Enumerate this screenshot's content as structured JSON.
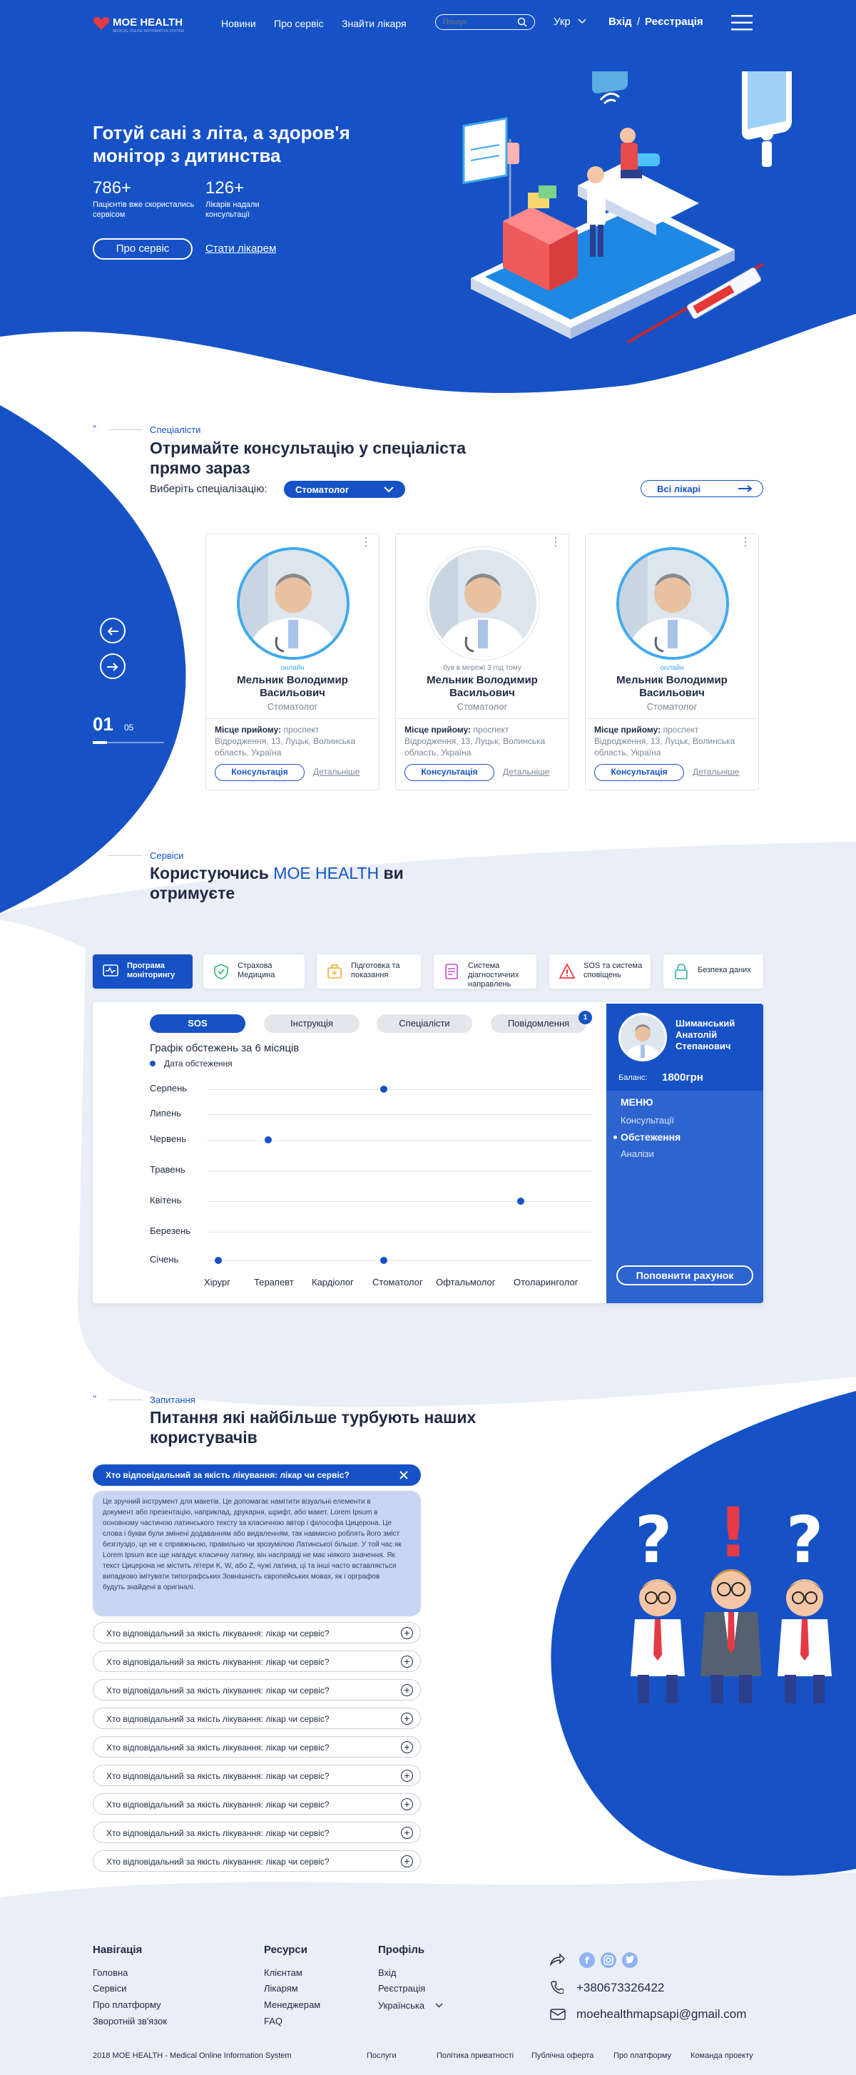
{
  "colors": {
    "brand": "#1652c6",
    "accent_light": "#3fa9ee",
    "danger": "#e63946",
    "bg_light": "#eaeef6"
  },
  "header": {
    "logo_text": "МОЕ HEALTH",
    "logo_sub": "MEDICAL ONLINE INFORMATION SYSTEM",
    "nav": [
      "Новини",
      "Про сервіс",
      "Знайти лікаря"
    ],
    "search_placeholder": "Пошук",
    "language": "Укр",
    "login": "Вхід",
    "separator": "/",
    "register": "Реєстрація"
  },
  "hero": {
    "title": "Готуй сані з літа, а здоров'я монітор з дитинства",
    "stat1_value": "786+",
    "stat1_label": "Пацієнтів вже скористались сервісом",
    "stat2_value": "126+",
    "stat2_label": "Лікарів надали консультації",
    "btn_about": "Про сервіс",
    "btn_doctor": "Стати лікарем"
  },
  "specialists": {
    "tag": "Спеціалісти",
    "title": "Отримайте консультацію у спеціаліста прямо зараз",
    "filter_label": "Виберіть спеціалізацію:",
    "filter_value": "Стоматолог",
    "all_doctors": "Всі лікарі",
    "slide_current": "01",
    "slide_total": "05",
    "cards": [
      {
        "status": "онлайн",
        "name": "Мельник Володимир Васильович",
        "spec": "Стоматолог",
        "addr_label": "Місце прийому:",
        "addr": "проспект Відродження, 13, Луцьк, Волинська область, Україна",
        "btn": "Консультація",
        "more": "Детальніше"
      },
      {
        "status": "був в мережі 3 год тому",
        "name": "Мельник Володимир Васильович",
        "spec": "Стоматолог",
        "addr_label": "Місце прийому:",
        "addr": "проспект Відродження, 13, Луцьк, Волинська область, Україна",
        "btn": "Консультація",
        "more": "Детальніше"
      },
      {
        "status": "онлайн",
        "name": "Мельник Володимир Васильович",
        "spec": "Стоматолог",
        "addr_label": "Місце прийому:",
        "addr": "проспект Відродження, 13, Луцьк, Волинська область, Україна",
        "btn": "Консультація",
        "more": "Детальніше"
      }
    ]
  },
  "services": {
    "tag": "Сервіси",
    "title_a": "Користуючись ",
    "title_brand": "МОЕ HEALTH",
    "title_b": " ви отримуєте",
    "tabs": [
      {
        "label": "Програма моніторингу",
        "icon": "monitor-icon"
      },
      {
        "label": "Страхова Медицина",
        "icon": "shield-icon"
      },
      {
        "label": "Підготовка та показання",
        "icon": "briefcase-icon"
      },
      {
        "label": "Система діагностичних направлень",
        "icon": "document-icon"
      },
      {
        "label": "SOS та система сповіщень",
        "icon": "warning-icon"
      },
      {
        "label": "Безпека даних",
        "icon": "lock-icon"
      }
    ],
    "pills": [
      "SOS",
      "Інструкція",
      "Спеціалісти",
      "Повідомлення"
    ],
    "notif_count": "1",
    "chart_title": "Графік обстежень за 6 місяців",
    "legend": "Дата обстеження",
    "profile": {
      "name": "Шиманський Анатолій Степанович",
      "balance_label": "Баланс:",
      "balance": "1800грн",
      "menu_title": "МЕНЮ",
      "menu": [
        "Консультації",
        "Обстеження",
        "Аналізи"
      ],
      "topup": "Поповнити рахунок"
    }
  },
  "chart_data": {
    "type": "scatter",
    "title": "Графік обстежень за 6 місяців",
    "x_categories": [
      "Хірург",
      "Терапевт",
      "Кардіолог",
      "Стоматолог",
      "Офтальмолог",
      "Отоларинголог"
    ],
    "y_categories": [
      "Серпень",
      "Липень",
      "Червень",
      "Травень",
      "Квітень",
      "Березень",
      "Січень"
    ],
    "series": [
      {
        "name": "Дата обстеження",
        "points": [
          {
            "x": "Стоматолог",
            "y": "Серпень"
          },
          {
            "x": "Терапевт",
            "y": "Червень"
          },
          {
            "x": "Отоларинголог",
            "y": "Квітень"
          },
          {
            "x": "Хірург",
            "y": "Січень"
          },
          {
            "x": "Стоматолог",
            "y": "Січень"
          }
        ]
      }
    ],
    "legend": "top-left",
    "grid": true
  },
  "faq": {
    "tag": "Запитання",
    "title": "Питання які найбільше турбують наших користувачів",
    "open_question": "Хто відповідальний за якість лікування: лікар чи сервіс?",
    "open_answer": "Це зручний інструмент для макетів. Це допомагає намітити візуальні елементи в документ або презентацію, наприклад, друкарня, шрифт, або макет. Lorem Ipsum в основному частиною латинського тексту за класичною автор і філософа Цицерона. Це слова і букви були змінені додаванням або видаленням, так навмисно роблять його зміст безглуздо, це не є справжньою, правильно чи зрозумілою Латинської більше. У той час як Lorem Ipsum все ще нагадує класичну латину, він насправді не має ніякого значення. Як текст Цицерона не містить літери K, W, або Z, чужі латина, ці та інші часто вставляється випадково імітувати типографських Зовнішність європейських мовах, як і орграфов будуть знайдені в оригіналі.",
    "questions": [
      "Хто відповідальний за якість лікування: лікар чи сервіс?",
      "Хто відповідальний за якість лікування: лікар чи сервіс?",
      "Хто відповідальний за якість лікування: лікар чи сервіс?",
      "Хто відповідальний за якість лікування: лікар чи сервіс?",
      "Хто відповідальний за якість лікування: лікар чи сервіс?",
      "Хто відповідальний за якість лікування: лікар чи сервіс?",
      "Хто відповідальний за якість лікування: лікар чи сервіс?",
      "Хто відповідальний за якість лікування: лікар чи сервіс?",
      "Хто відповідальний за якість лікування: лікар чи сервіс?"
    ]
  },
  "footer": {
    "nav_title": "Навігація",
    "nav": [
      "Головна",
      "Сервіси",
      "Про платформу",
      "Зворотній зв'язок"
    ],
    "res_title": "Ресурси",
    "res": [
      "Клієнтам",
      "Лікарям",
      "Менеджерам",
      "FAQ"
    ],
    "profile_title": "Профіль",
    "profile": [
      "Вхід",
      "Реєстрація",
      "Українська"
    ],
    "phone": "+380673326422",
    "email": "moehealthmapsapi@gmail.com",
    "copyright": "2018 МОЕ HEALTH - Medical Online Information System",
    "bottom_links": [
      "Послуги",
      "Політика приватності",
      "Публічна оферта",
      "Про платформу",
      "Команда проекту"
    ]
  }
}
